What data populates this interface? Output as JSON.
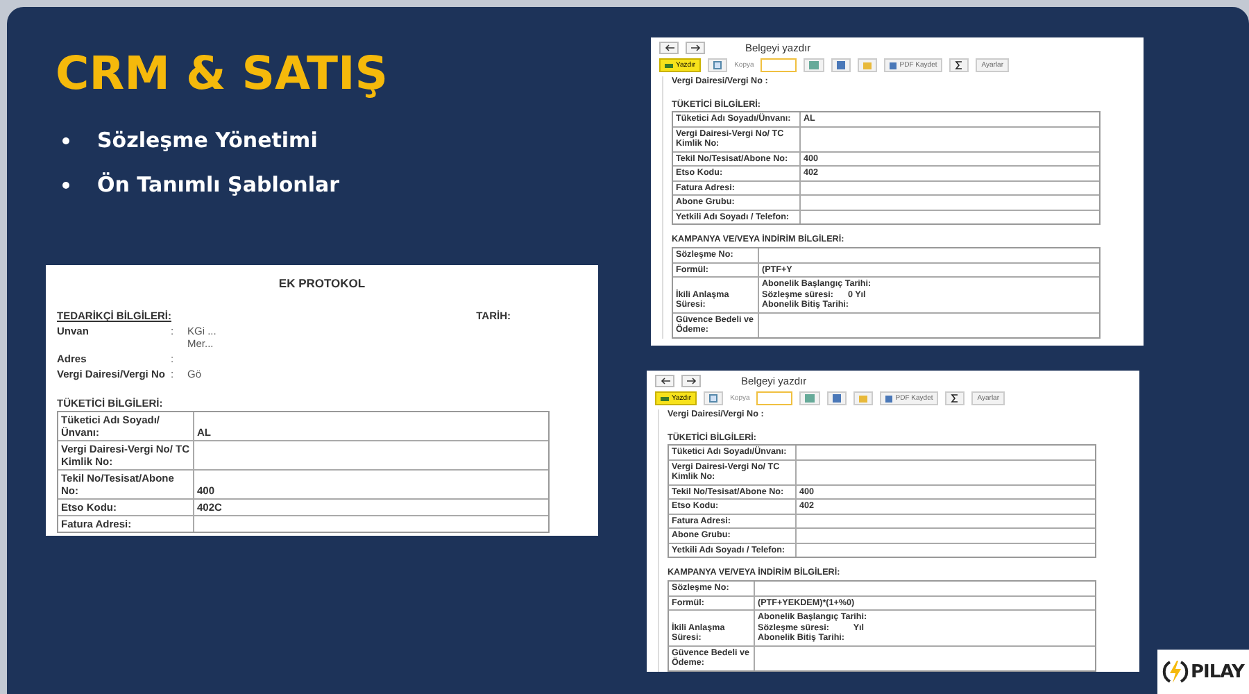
{
  "slide": {
    "title": "CRM & SATIŞ",
    "bullets": [
      "Sözleşme Yönetimi",
      "Ön Tanımlı Şablonlar"
    ]
  },
  "protocol_document": {
    "title": "EK PROTOKOL",
    "supplier_heading": "TEDARİKÇİ BİLGİLERİ:",
    "date_label": "TARİH:",
    "supplier_fields": [
      {
        "label": "Unvan",
        "separator": ":",
        "lines": [
          "KGi ...",
          "Mer..."
        ]
      },
      {
        "label": "Adres",
        "separator": ":"
      },
      {
        "label": "Vergi Dairesi/Vergi No",
        "separator": ":",
        "lines": [
          "Gö"
        ]
      }
    ],
    "consumer_heading": "TÜKETİCİ BİLGİLERİ:",
    "consumer_rows": [
      {
        "label": "Tüketici Adı Soyadı/Ünvanı:",
        "value": "AL"
      },
      {
        "label": "Vergi Dairesi-Vergi No/ TC Kimlik No:"
      },
      {
        "label": "Tekil No/Tesisat/Abone No:",
        "value": "400"
      },
      {
        "label": "Etso Kodu:",
        "value": "402C"
      },
      {
        "label": "Fatura Adresi:"
      }
    ]
  },
  "print_previews": [
    {
      "title": "Belgeyi yazdır",
      "print_button": "Yazdır",
      "copies_label": "Kopya",
      "pdf_button": "PDF Kaydet",
      "settings_button": "Ayarlar",
      "tax_line": "Vergi Dairesi/Vergi No  :",
      "consumer_heading": "TÜKETİCİ BİLGİLERİ:",
      "consumer_rows": [
        {
          "label": "Tüketici Adı Soyadı/Ünvanı:",
          "value": "AL"
        },
        {
          "label": "Vergi Dairesi-Vergi No/ TC Kimlik No:"
        },
        {
          "label": "Tekil No/Tesisat/Abone No:",
          "value": "400"
        },
        {
          "label": "Etso Kodu:",
          "value": "402"
        },
        {
          "label": "Fatura Adresi:"
        },
        {
          "label": "Abone Grubu:"
        },
        {
          "label": "Yetkili Adı Soyadı / Telefon:"
        }
      ],
      "campaign_heading": "KAMPANYA VE/VEYA İNDİRİM BİLGİLERİ:",
      "campaign_rows": [
        {
          "label": "Sözleşme No:"
        },
        {
          "label": "Formül:",
          "lines": [
            "(PTF+Y"
          ]
        },
        {
          "label": "İkili Anlaşma Süresi:",
          "lines": [
            "Abonelik Başlangıç Tarihi:",
            "Sözleşme süresi:      0 Yıl",
            "Abonelik Bitiş Tarihi:"
          ]
        },
        {
          "label": "Güvence Bedeli ve Ödeme:"
        }
      ]
    },
    {
      "title": "Belgeyi yazdır",
      "print_button": "Yazdır",
      "copies_label": "Kopya",
      "pdf_button": "PDF Kaydet",
      "settings_button": "Ayarlar",
      "tax_line": "Vergi Dairesi/Vergi No  :",
      "consumer_heading": "TÜKETİCİ BİLGİLERİ:",
      "consumer_rows": [
        {
          "label": "Tüketici Adı Soyadı/Ünvanı:"
        },
        {
          "label": "Vergi Dairesi-Vergi No/ TC Kimlik No:"
        },
        {
          "label": "Tekil No/Tesisat/Abone No:",
          "value": "400"
        },
        {
          "label": "Etso Kodu:",
          "value": "402"
        },
        {
          "label": "Fatura Adresi:"
        },
        {
          "label": "Abone Grubu:"
        },
        {
          "label": "Yetkili Adı Soyadı / Telefon:"
        }
      ],
      "campaign_heading": "KAMPANYA VE/VEYA İNDİRİM BİLGİLERİ:",
      "campaign_rows": [
        {
          "label": "Sözleşme No:"
        },
        {
          "label": "Formül:",
          "lines": [
            "(PTF+YEKDEM)*(1+%0)"
          ]
        },
        {
          "label": "İkili Anlaşma Süresi:",
          "lines": [
            "Abonelik Başlangıç Tarihi:",
            "Sözleşme süresi:          Yıl",
            "Abonelik Bitiş Tarihi:"
          ]
        },
        {
          "label": "Güvence Bedeli ve Ödeme:"
        }
      ]
    }
  ],
  "logo": {
    "text": "PILAY"
  }
}
